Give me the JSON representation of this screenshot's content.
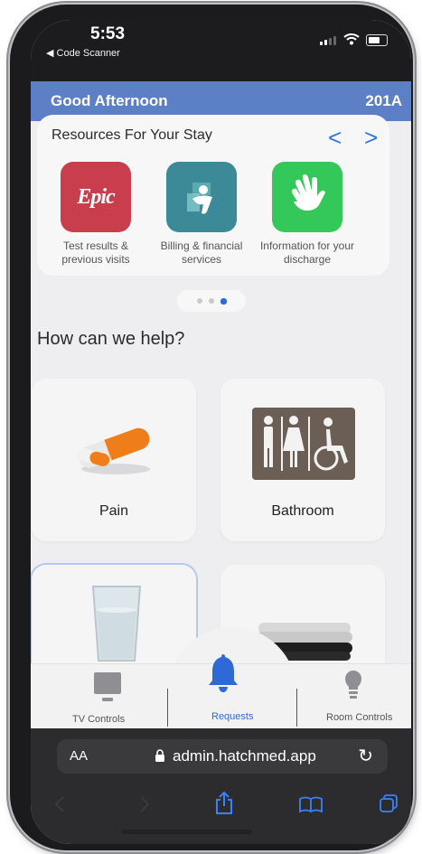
{
  "status": {
    "time": "5:53",
    "back_app": "◀ Code Scanner"
  },
  "header": {
    "greeting": "Good Afternoon",
    "room": "201A"
  },
  "resources": {
    "title": "Resources For Your Stay",
    "prev": "<",
    "next": ">",
    "items": [
      {
        "icon_text": "Epic",
        "label": "Test results & previous visits",
        "color": "#c83e4d"
      },
      {
        "icon": "health-person-icon",
        "label": "Billing & financial services",
        "color": "#3c8a97"
      },
      {
        "icon": "hand-wave-icon",
        "label": "Information for your discharge",
        "color": "#34c759"
      }
    ]
  },
  "pager": {
    "count": 3,
    "active": 3
  },
  "help": {
    "title": "How can we help?"
  },
  "tiles": [
    {
      "label": "Pain",
      "icon": "pills-icon"
    },
    {
      "label": "Bathroom",
      "icon": "restroom-sign-icon"
    },
    {
      "label": "",
      "icon": "water-glass-icon"
    },
    {
      "label": "",
      "icon": "towels-icon"
    }
  ],
  "tabbar": {
    "tv": "TV Controls",
    "requests": "Requests",
    "room": "Room Controls"
  },
  "browser": {
    "aa": "AA",
    "url": "admin.hatchmed.app",
    "reload": "↻"
  },
  "colors": {
    "header": "#5d7fc5",
    "accent": "#2f69d6",
    "tab_active": "#2f69d6"
  }
}
